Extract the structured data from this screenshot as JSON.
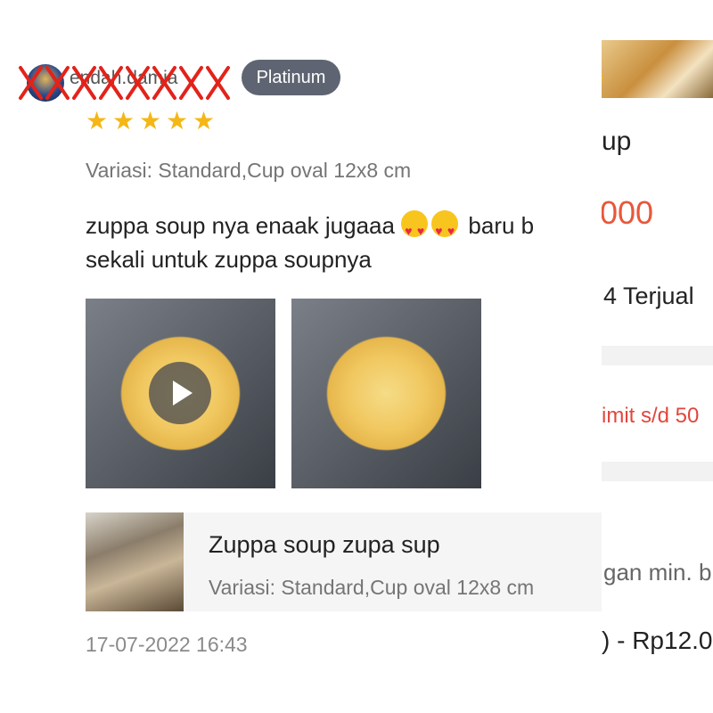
{
  "background_page": {
    "title_fragment": "up",
    "price_fragment": "000",
    "sold_fragment": "4 Terjual",
    "limit_fragment": "imit s/d 50",
    "min_fragment": "gan min. b",
    "range_fragment": ") - Rp12.0"
  },
  "review": {
    "username": "endah.damia",
    "badge": "Platinum",
    "rating": 5,
    "variation": "Variasi: Standard,Cup oval 12x8 cm",
    "text_part1": "zuppa soup nya enaak jugaaa",
    "text_part2": "baru b",
    "text_line2": "sekali untuk zuppa soupnya",
    "emoji": [
      "heart-eyes-emoji",
      "heart-eyes-emoji"
    ],
    "media": [
      {
        "type": "video",
        "icon": "play-icon"
      },
      {
        "type": "image"
      }
    ],
    "product": {
      "name": "Zuppa soup zupa sup",
      "variation": "Variasi: Standard,Cup oval 12x8 cm"
    },
    "timestamp": "17-07-2022 16:43"
  },
  "colors": {
    "star": "#f5b716",
    "badge_bg": "#5f6472",
    "price": "#e8573a",
    "limit_text": "#e2463d",
    "redaction": "#e2231a"
  }
}
